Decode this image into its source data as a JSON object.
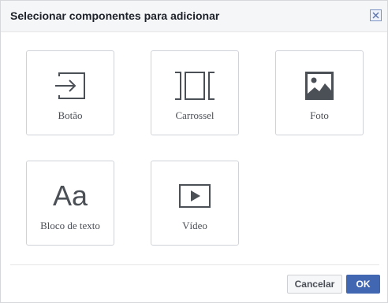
{
  "dialog": {
    "title": "Selecionar componentes para adicionar"
  },
  "components": [
    {
      "label": "Botão",
      "icon": "button-arrow-icon"
    },
    {
      "label": "Carrossel",
      "icon": "carousel-icon"
    },
    {
      "label": "Foto",
      "icon": "photo-icon"
    },
    {
      "label": "Bloco de texto",
      "icon": "text-block-icon",
      "glyph": "Aa"
    },
    {
      "label": "Vídeo",
      "icon": "video-play-icon"
    }
  ],
  "footer": {
    "cancel_label": "Cancelar",
    "ok_label": "OK"
  },
  "colors": {
    "accent": "#4267b2",
    "icon": "#4b4f56",
    "border": "#cfd3d9"
  }
}
